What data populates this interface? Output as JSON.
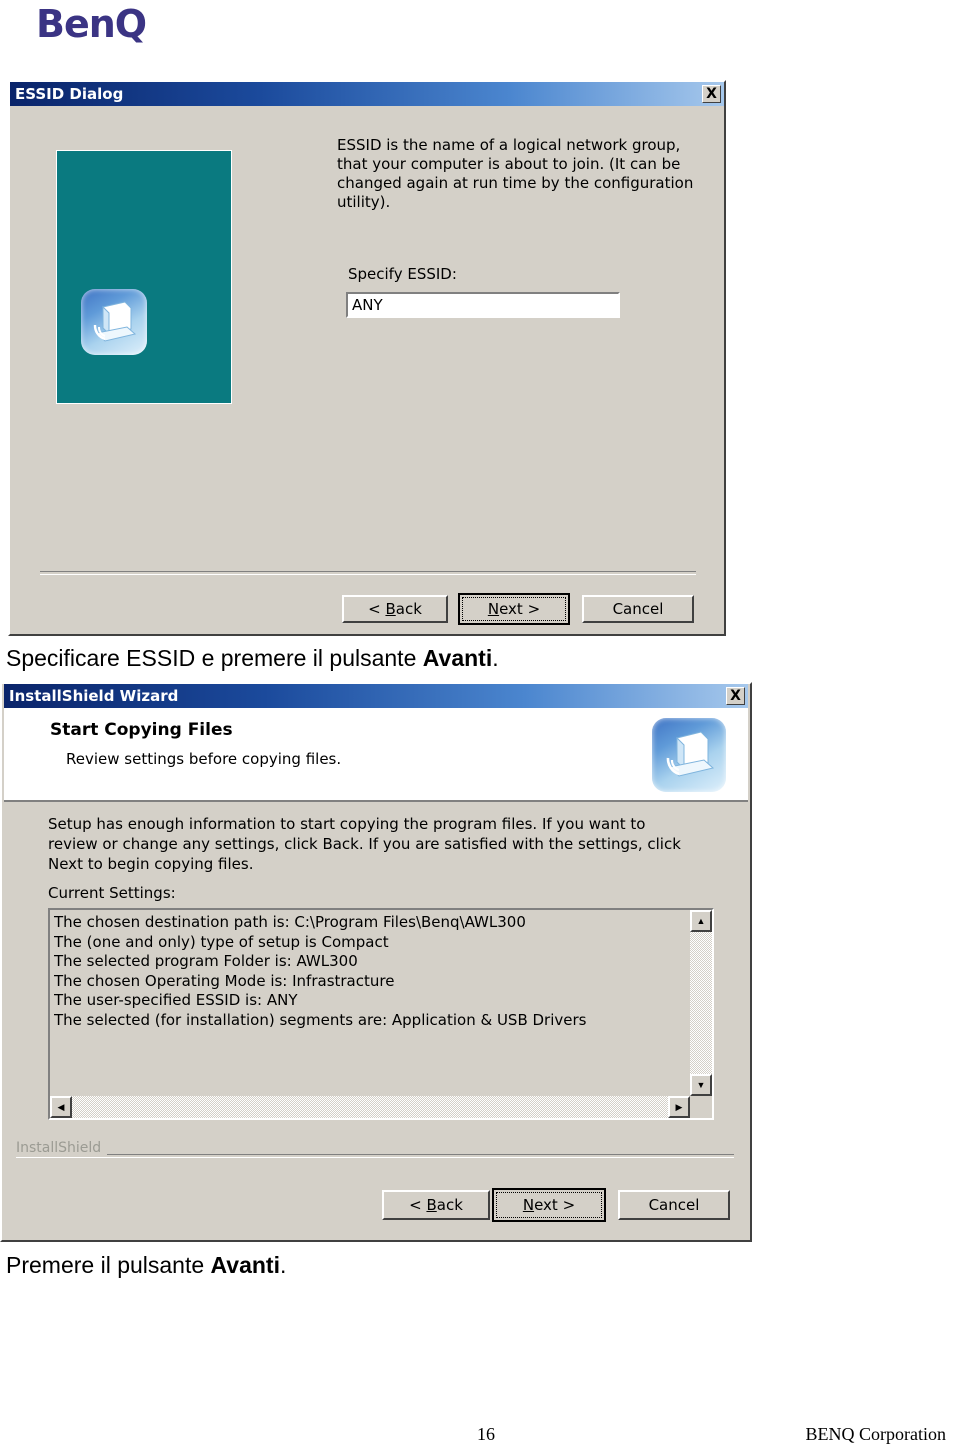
{
  "page": {
    "brand_logo": "BenQ",
    "footer_page_number": "16",
    "footer_corporation": "BENQ Corporation",
    "caption_1_text": "Specificare ESSID e premere il pulsante ",
    "caption_1_bold": "Avanti",
    "caption_1_end": ".",
    "caption_2_text": "Premere il pulsante ",
    "caption_2_bold": "Avanti",
    "caption_2_end": "."
  },
  "colors": {
    "brand": "#3b3484",
    "dialog_face": "#d4d0c8",
    "titlebar_start": "#0a246a",
    "titlebar_end": "#a6c8ec",
    "side_panel_teal": "#0a7a80",
    "installshield_gray": "#9b9b93"
  },
  "essid_dialog": {
    "title": "ESSID Dialog",
    "close_label": "X",
    "description": "ESSID is the name of a logical network group, that your computer is about to join. (It can be changed again at run time by the configuration utility).",
    "field_label": "Specify ESSID:",
    "field_value": "ANY",
    "buttons": {
      "back_prefix": "< ",
      "back_accel": "B",
      "back_rest": "ack",
      "next_accel": "N",
      "next_rest": "ext >",
      "cancel": "Cancel"
    }
  },
  "installshield_dialog": {
    "title": "InstallShield Wizard",
    "close_label": "X",
    "header_title": "Start Copying Files",
    "header_subtitle": "Review settings before copying files.",
    "paragraph": "Setup has enough information to start copying the program files.  If you want to review or change any settings, click Back.  If you are satisfied with the settings, click Next to begin copying files.",
    "current_settings_label": "Current Settings:",
    "settings_list": [
      "The chosen destination path is: C:\\Program Files\\Benq\\AWL300",
      "The (one and only) type of setup is Compact",
      "The selected program Folder is: AWL300",
      "The chosen Operating Mode is: Infrastracture",
      "The user-specified ESSID is:  ANY",
      "The selected (for installation) segments are: Application & USB Drivers"
    ],
    "scroll_up_glyph": "▲",
    "scroll_down_glyph": "▼",
    "scroll_left_glyph": "◀",
    "scroll_right_glyph": "▶",
    "branding": "InstallShield",
    "buttons": {
      "back_prefix": "< ",
      "back_accel": "B",
      "back_rest": "ack",
      "next_accel": "N",
      "next_rest": "ext >",
      "cancel": "Cancel"
    }
  }
}
